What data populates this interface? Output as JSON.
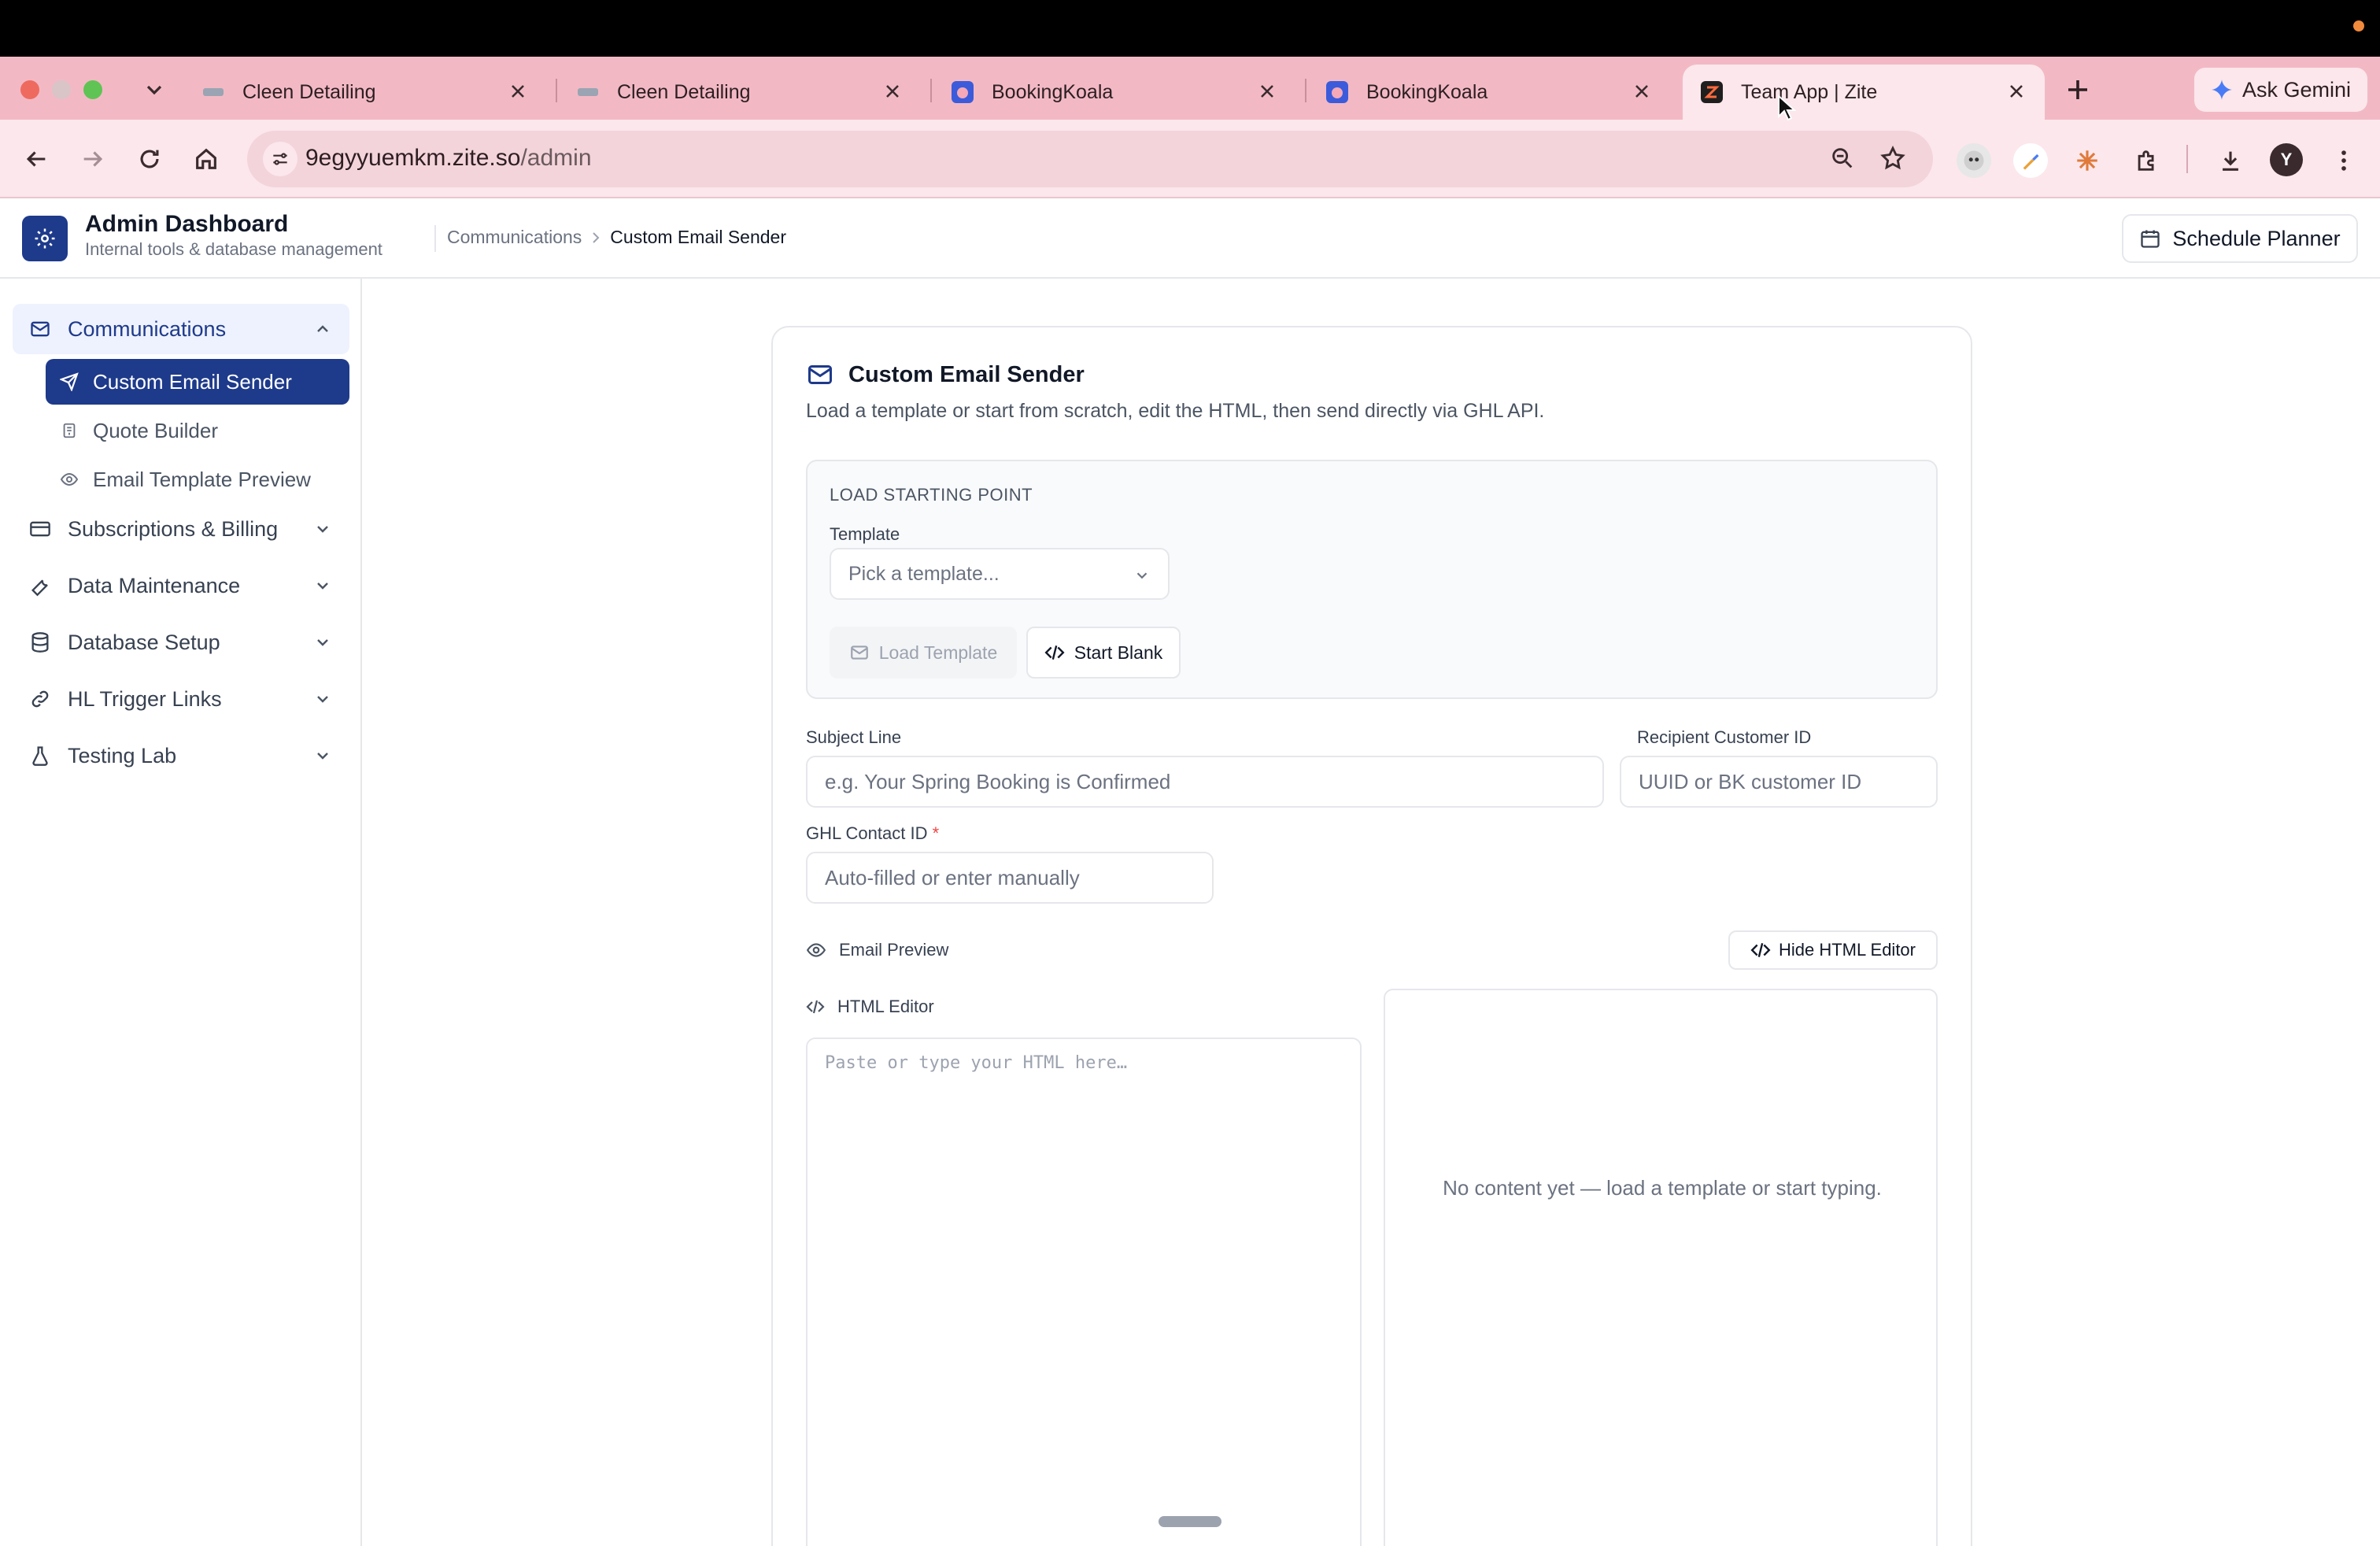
{
  "browser": {
    "tabs": [
      {
        "title": "Cleen Detailing",
        "favicon": "cleen-icon"
      },
      {
        "title": "Cleen Detailing",
        "favicon": "cleen-icon"
      },
      {
        "title": "BookingKoala",
        "favicon": "bookingkoala-icon"
      },
      {
        "title": "BookingKoala",
        "favicon": "bookingkoala-icon"
      },
      {
        "title": "Team App | Zite",
        "favicon": "zite-icon",
        "active": true
      }
    ],
    "ask_gemini": "Ask Gemini",
    "url_host": "9egyyuemkm.zite.so",
    "url_path": "/admin",
    "profile_initial": "Y",
    "colors": {
      "tabstrip": "#f2b9c4",
      "toolbar": "#fbe7ec"
    }
  },
  "header": {
    "title": "Admin Dashboard",
    "subtitle": "Internal tools & database management",
    "breadcrumb": [
      "Communications",
      "Custom Email Sender"
    ],
    "schedule_button": "Schedule Planner"
  },
  "sidebar": {
    "groups": [
      {
        "label": "Communications",
        "icon": "mail-icon",
        "expanded": true,
        "items": [
          {
            "label": "Custom Email Sender",
            "icon": "send-icon",
            "active": true
          },
          {
            "label": "Quote Builder",
            "icon": "receipt-icon"
          },
          {
            "label": "Email Template Preview",
            "icon": "eye-icon"
          }
        ]
      },
      {
        "label": "Subscriptions & Billing",
        "icon": "credit-card-icon",
        "expanded": false
      },
      {
        "label": "Data Maintenance",
        "icon": "wrench-icon",
        "expanded": false
      },
      {
        "label": "Database Setup",
        "icon": "database-icon",
        "expanded": false
      },
      {
        "label": "HL Trigger Links",
        "icon": "link-icon",
        "expanded": false
      },
      {
        "label": "Testing Lab",
        "icon": "flask-icon",
        "expanded": false
      }
    ],
    "accent": "#1e3a8a"
  },
  "main": {
    "title": "Custom Email Sender",
    "description": "Load a template or start from scratch, edit the HTML, then send directly via GHL API.",
    "starting_point": {
      "heading": "LOAD STARTING POINT",
      "template_label": "Template",
      "template_placeholder": "Pick a template...",
      "load_button": "Load Template",
      "blank_button": "Start Blank"
    },
    "subject": {
      "label": "Subject Line",
      "placeholder": "e.g. Your Spring Booking is Confirmed"
    },
    "recipient": {
      "label": "Recipient Customer ID",
      "placeholder": "UUID or BK customer ID"
    },
    "ghl_contact": {
      "label": "GHL Contact ID",
      "required_mark": "*",
      "placeholder": "Auto-filled or enter manually"
    },
    "preview_label": "Email Preview",
    "hide_editor_button": "Hide HTML Editor",
    "editor_label": "HTML Editor",
    "editor_placeholder": "Paste or type your HTML here…",
    "preview_empty": "No content yet — load a template or start typing."
  }
}
